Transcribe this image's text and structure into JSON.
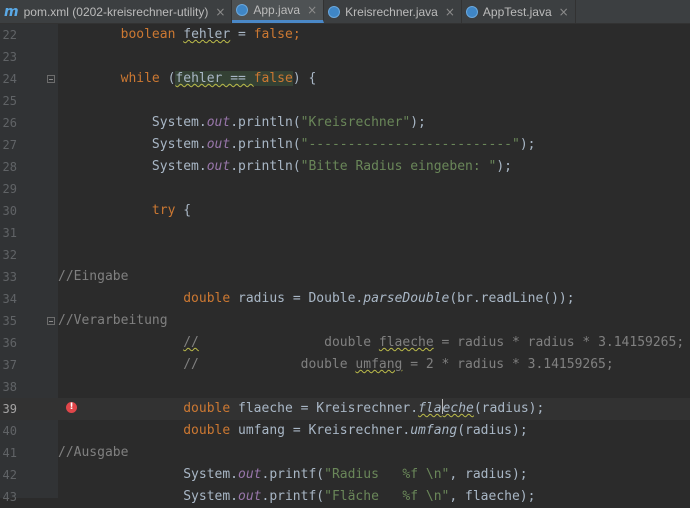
{
  "tabs": [
    {
      "icon": "m",
      "label": "pom.xml (0202-kreisrechner-utility)",
      "close": "×"
    },
    {
      "label": "App.java",
      "close": "×"
    },
    {
      "label": "Kreisrechner.java",
      "close": "×"
    },
    {
      "label": "AppTest.java",
      "close": "×"
    }
  ],
  "editor": {
    "active_tab": "App.java",
    "current_line": 39,
    "lines": [
      {
        "n": "22",
        "t": [
          "        ",
          "boolean ",
          "fehler",
          " = ",
          "false",
          ";"
        ]
      },
      {
        "n": "23"
      },
      {
        "n": "24",
        "t": [
          "        ",
          "while ",
          "(",
          "fehler == ",
          "false",
          ") {"
        ]
      },
      {
        "n": "25"
      },
      {
        "n": "26",
        "t": [
          "            System.",
          "out",
          ".println(",
          "\"Kreisrechner\"",
          ");"
        ]
      },
      {
        "n": "27",
        "t": [
          "            System.",
          "out",
          ".println(",
          "\"--------------------------\"",
          ");"
        ]
      },
      {
        "n": "28",
        "t": [
          "            System.",
          "out",
          ".println(",
          "\"Bitte Radius eingeben: \"",
          ");"
        ]
      },
      {
        "n": "29"
      },
      {
        "n": "30",
        "t": [
          "            ",
          "try",
          " {"
        ]
      },
      {
        "n": "31"
      },
      {
        "n": "32"
      },
      {
        "n": "33",
        "t": [
          "//Eingabe"
        ]
      },
      {
        "n": "34",
        "t": [
          "                ",
          "double ",
          "radius = Double.",
          "parseDouble",
          "(br.readLine());"
        ]
      },
      {
        "n": "35",
        "t": [
          "//Verarbeitung"
        ]
      },
      {
        "n": "36",
        "t": [
          "                ",
          "//",
          "                double ",
          "flaeche",
          " = radius * radius * 3.14159265;"
        ]
      },
      {
        "n": "37",
        "t": [
          "                //             double ",
          "umfang",
          " = 2 * radius * 3.14159265;"
        ]
      },
      {
        "n": "38"
      },
      {
        "n": "39",
        "t": [
          "                ",
          "double ",
          "flaeche",
          " = Kreisrechner.",
          "fla",
          "eche",
          "(radius);"
        ]
      },
      {
        "n": "40",
        "t": [
          "                ",
          "double ",
          "umfang",
          " = Kreisrechner.",
          "umfang",
          "(radius);"
        ]
      },
      {
        "n": "41",
        "t": [
          "//Ausgabe"
        ]
      },
      {
        "n": "42",
        "t": [
          "                System.",
          "out",
          ".printf(",
          "\"Radius   %f \\n\"",
          ", radius);"
        ]
      },
      {
        "n": "43",
        "t": [
          "                System.",
          "out",
          ".printf(",
          "\"Fläche   %f \\n\"",
          ", flaeche);"
        ]
      }
    ]
  }
}
